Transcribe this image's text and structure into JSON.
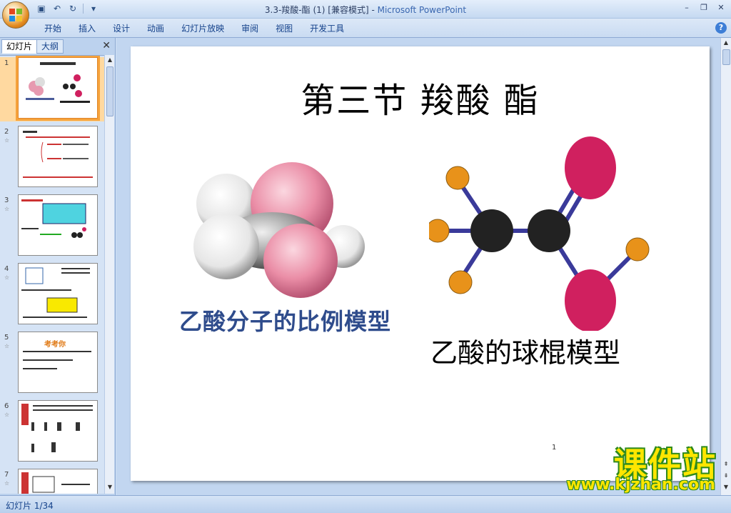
{
  "window": {
    "title_doc": "3.3-羧酸-酯 (1) [兼容模式] - ",
    "title_app": "Microsoft PowerPoint"
  },
  "ribbon": {
    "tabs": [
      "开始",
      "插入",
      "设计",
      "动画",
      "幻灯片放映",
      "审阅",
      "视图",
      "开发工具"
    ]
  },
  "left_pane": {
    "tab_slides": "幻灯片",
    "tab_outline": "大纲",
    "thumbnails": [
      {
        "num": "1"
      },
      {
        "num": "2"
      },
      {
        "num": "3"
      },
      {
        "num": "4"
      },
      {
        "num": "5",
        "mini_title": "考考你"
      },
      {
        "num": "6"
      },
      {
        "num": "7"
      }
    ]
  },
  "slide": {
    "title": "第三节  羧酸  酯",
    "spacefill_label": "乙酸分子的比例模型",
    "ballstick_label": "乙酸的球棍模型",
    "pagedot": "1"
  },
  "status": {
    "slide_counter": "幻灯片 1/34"
  },
  "watermark": {
    "brand": "课件站",
    "url": "www.kjzhan.com"
  },
  "colors": {
    "accent_orange": "#f6a33c",
    "ribbon_text": "#15428b",
    "pink_atom": "#e0336a",
    "watermark_yellow": "#ffe600"
  }
}
